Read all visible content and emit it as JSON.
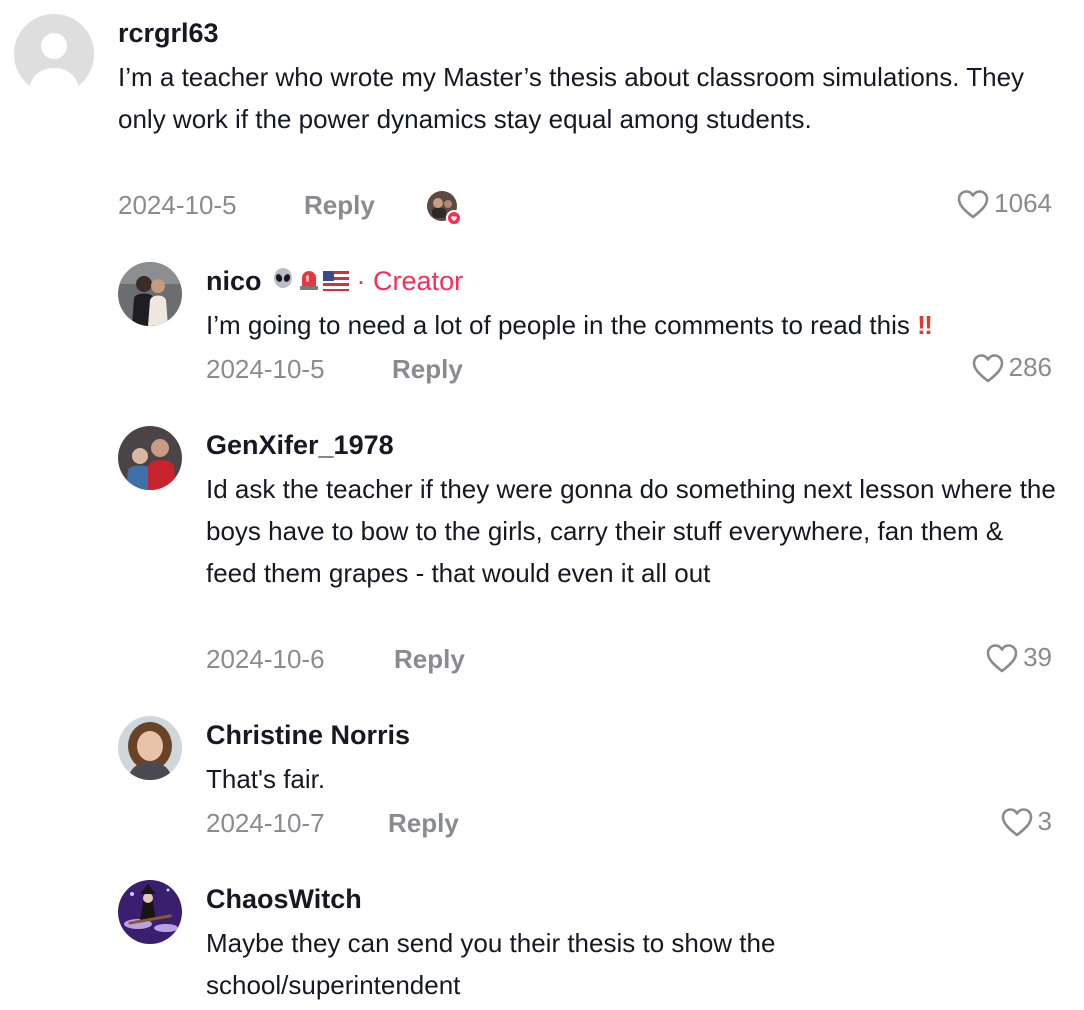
{
  "comments": [
    {
      "username": "rcrgrl63",
      "text": "I’m a teacher who wrote my Master’s thesis about classroom simulations. They only work if the power dynamics stay equal among students.",
      "date": "2024-10-5",
      "reply_label": "Reply",
      "likes": "1064"
    },
    {
      "username": "nico",
      "creator_label": "· Creator",
      "text": "I’m going to need a lot of people in the comments to read this",
      "date": "2024-10-5",
      "reply_label": "Reply",
      "likes": "286"
    },
    {
      "username": "GenXifer_1978",
      "text": "Id ask the teacher if they were gonna do something next lesson where the boys have to bow to the girls, carry their stuff everywhere, fan them & feed them grapes - that would even it all out",
      "date": "2024-10-6",
      "reply_label": "Reply",
      "likes": "39"
    },
    {
      "username": "Christine Norris",
      "text": "That's fair.",
      "date": "2024-10-7",
      "reply_label": "Reply",
      "likes": "3"
    },
    {
      "username": "ChaosWitch",
      "text": "Maybe they can send you their thesis to show the school/superintendent"
    }
  ],
  "colors": {
    "creator": "#fe2c55",
    "meta": "#8a8b91",
    "text": "#161823"
  },
  "icons": [
    "default-avatar-icon",
    "alien-emoji-icon",
    "siren-emoji-icon",
    "us-flag-emoji-icon",
    "double-exclamation-icon",
    "heart-outline-icon",
    "creator-liked-badge-icon"
  ]
}
